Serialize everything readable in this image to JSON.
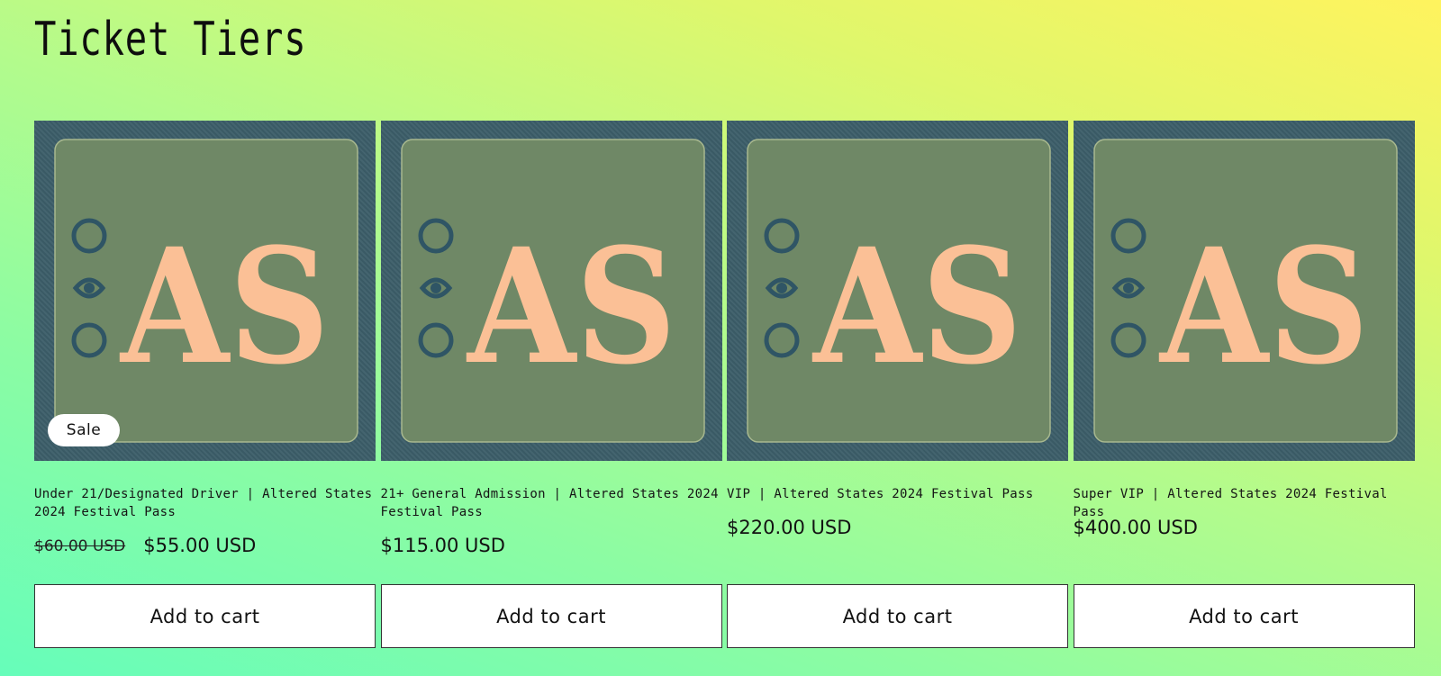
{
  "page": {
    "title": "Ticket Tiers"
  },
  "products": [
    {
      "title": "Under 21/Designated Driver | Altered States 2024 Festival Pass",
      "price_old": "$60.00 USD",
      "price": "$55.00 USD",
      "badge": "Sale",
      "button_label": "Add to cart",
      "image_text": "AS"
    },
    {
      "title": "21+ General Admission | Altered States 2024 Festival Pass",
      "price": "$115.00 USD",
      "button_label": "Add to cart",
      "image_text": "AS"
    },
    {
      "title": "VIP | Altered States 2024 Festival Pass",
      "price": "$220.00 USD",
      "button_label": "Add to cart",
      "image_text": "AS"
    },
    {
      "title": "Super VIP | Altered States 2024 Festival Pass",
      "price": "$400.00 USD",
      "button_label": "Add to cart",
      "image_text": "AS"
    }
  ],
  "colors": {
    "image_border": "#3c5e69",
    "image_panel": "#6f8866",
    "logo_letters": "#fbc096",
    "logo_icon": "#2f5565"
  }
}
